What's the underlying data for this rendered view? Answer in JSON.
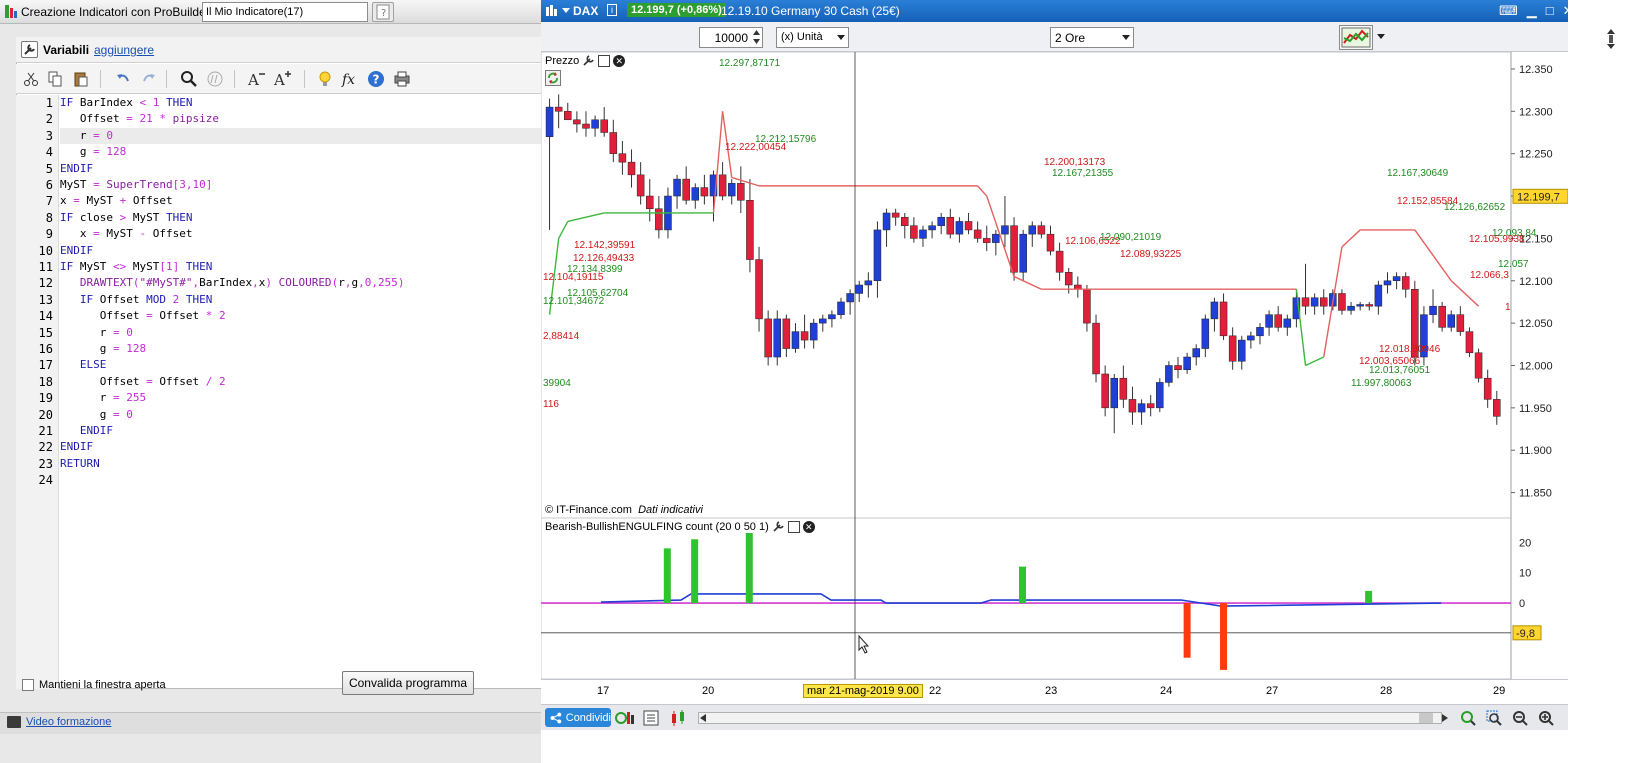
{
  "left_window": {
    "title": "Creazione Indicatori con ProBuilder",
    "separator": "-",
    "indicator_name": "Il Mio Indicatore(17)",
    "variables_label": "Variabili",
    "add_link": "aggiungere",
    "code_lines": [
      "IF BarIndex < 1 THEN",
      "   Offset = 21 * pipsize",
      "   r = 0",
      "   g = 128",
      "ENDIF",
      "MyST = SuperTrend[3,10]",
      "x = MyST + Offset",
      "IF close > MyST THEN",
      "   x = MyST - Offset",
      "ENDIF",
      "IF MyST <> MyST[1] THEN",
      "   DRAWTEXT(\"#MyST#\",BarIndex,x) COLOURED(r,g,0,255)",
      "   IF Offset MOD 2 THEN",
      "      Offset = Offset * 2",
      "      r = 0",
      "      g = 128",
      "   ELSE",
      "      Offset = Offset / 2",
      "      r = 255",
      "      g = 0",
      "   ENDIF",
      "ENDIF",
      "RETURN",
      ""
    ],
    "line_numbers": [
      "1",
      "2",
      "3",
      "4",
      "5",
      "6",
      "7",
      "8",
      "9",
      "10",
      "11",
      "12",
      "13",
      "14",
      "15",
      "16",
      "17",
      "18",
      "19",
      "20",
      "21",
      "22",
      "23",
      "24"
    ],
    "keep_open_label": "Mantieni la finestra aperta",
    "validate_button": "Convalida programma",
    "video_link": "Video formazione"
  },
  "chart_window": {
    "symbol": "DAX",
    "price_badge": "12.199,7 (+0,86%)",
    "description": "12.19.10 Germany 30 Cash (25€)",
    "quantity": "10000",
    "unit": "(x) Unità",
    "timeframe": "2 Ore",
    "panel1_label": "Prezzo",
    "panel2_label": "Bearish-BullishENGULFING count (20 0 50 1)",
    "copyright": "© IT-Finance.com",
    "copyright_note": "Dati indicativi",
    "share_button": "Condividi",
    "cursor_date": "mar 21-mag-2019 9.00",
    "x_labels": [
      "17",
      "20",
      "22",
      "23",
      "24",
      "27",
      "28",
      "29"
    ],
    "price_axis": [
      "12.350",
      "12.300",
      "12.250",
      "12.200",
      "12.150",
      "12.100",
      "12.050",
      "12.000",
      "11.950",
      "11.900",
      "11.850"
    ],
    "last_price": "12.199,7",
    "ind_axis": [
      "20",
      "10",
      "0"
    ],
    "ind_cursor_value": "-9,8",
    "colors": {
      "up": "#1f3fd6",
      "down": "#e0203a",
      "st_red": "#e46060",
      "st_green": "#3cb83c",
      "text_red": "#d01818",
      "text_green": "#1f8c1f",
      "title_blue": "#1f6fc8",
      "badge_green": "#2e9e31"
    }
  },
  "chart_data": {
    "type": "candlestick",
    "price_labels": [
      {
        "text": "12.297,87171",
        "color": "green"
      },
      {
        "text": "12.212,15796",
        "color": "green"
      },
      {
        "text": "12.222,00454",
        "color": "red"
      },
      {
        "text": "12.200,13173",
        "color": "red"
      },
      {
        "text": "12.167,21355",
        "color": "green"
      },
      {
        "text": "12.142,39591",
        "color": "red"
      },
      {
        "text": "12.126,49433",
        "color": "red"
      },
      {
        "text": "12.104,19115",
        "color": "red"
      },
      {
        "text": "12.134,8399",
        "color": "green"
      },
      {
        "text": "12.105,62704",
        "color": "green"
      },
      {
        "text": "12.101,34672",
        "color": "green"
      },
      {
        "text": "2,88414",
        "color": "red"
      },
      {
        "text": "39904",
        "color": "green"
      },
      {
        "text": "116",
        "color": "red"
      },
      {
        "text": "12.106,6522",
        "color": "red"
      },
      {
        "text": "12.090,21019",
        "color": "green"
      },
      {
        "text": "12.089,93225",
        "color": "red"
      },
      {
        "text": "12.167,30649",
        "color": "green"
      },
      {
        "text": "12.152,85584",
        "color": "red"
      },
      {
        "text": "12.126,62652",
        "color": "green"
      },
      {
        "text": "12.093,84",
        "color": "green"
      },
      {
        "text": "12.105,9938",
        "color": "red"
      },
      {
        "text": "12.057",
        "color": "green"
      },
      {
        "text": "12.066,3",
        "color": "red"
      },
      {
        "text": "1",
        "color": "red"
      },
      {
        "text": "12.018,30946",
        "color": "red"
      },
      {
        "text": "12.003,65066",
        "color": "red"
      },
      {
        "text": "12.013,76051",
        "color": "green"
      },
      {
        "text": "11.997,80063",
        "color": "green"
      }
    ],
    "candles": [
      [
        12270,
        12315,
        12160,
        12305
      ],
      [
        12305,
        12320,
        12280,
        12300
      ],
      [
        12300,
        12310,
        12290,
        12290
      ],
      [
        12290,
        12300,
        12275,
        12285
      ],
      [
        12285,
        12300,
        12270,
        12280
      ],
      [
        12280,
        12295,
        12270,
        12290
      ],
      [
        12290,
        12305,
        12270,
        12275
      ],
      [
        12275,
        12290,
        12240,
        12250
      ],
      [
        12250,
        12265,
        12225,
        12240
      ],
      [
        12240,
        12255,
        12210,
        12225
      ],
      [
        12225,
        12240,
        12190,
        12200
      ],
      [
        12200,
        12220,
        12170,
        12185
      ],
      [
        12185,
        12200,
        12150,
        12160
      ],
      [
        12160,
        12210,
        12150,
        12200
      ],
      [
        12200,
        12225,
        12185,
        12220
      ],
      [
        12220,
        12235,
        12190,
        12195
      ],
      [
        12195,
        12215,
        12185,
        12210
      ],
      [
        12210,
        12225,
        12190,
        12200
      ],
      [
        12200,
        12230,
        12170,
        12225
      ],
      [
        12225,
        12240,
        12195,
        12200
      ],
      [
        12200,
        12220,
        12190,
        12215
      ],
      [
        12215,
        12235,
        12180,
        12195
      ],
      [
        12195,
        12220,
        12110,
        12125
      ],
      [
        12125,
        12140,
        12040,
        12055
      ],
      [
        12055,
        12065,
        12000,
        12010
      ],
      [
        12010,
        12065,
        12000,
        12055
      ],
      [
        12055,
        12060,
        12010,
        12020
      ],
      [
        12020,
        12050,
        12015,
        12040
      ],
      [
        12040,
        12060,
        12020,
        12030
      ],
      [
        12030,
        12055,
        12020,
        12050
      ],
      [
        12050,
        12060,
        12040,
        12055
      ],
      [
        12055,
        12065,
        12045,
        12060
      ],
      [
        12060,
        12080,
        12055,
        12075
      ],
      [
        12075,
        12090,
        12060,
        12085
      ],
      [
        12085,
        12100,
        12075,
        12095
      ],
      [
        12095,
        12110,
        12080,
        12100
      ],
      [
        12100,
        12170,
        12080,
        12160
      ],
      [
        12160,
        12185,
        12140,
        12180
      ],
      [
        12180,
        12185,
        12165,
        12175
      ],
      [
        12175,
        12180,
        12150,
        12165
      ],
      [
        12165,
        12175,
        12145,
        12150
      ],
      [
        12150,
        12165,
        12140,
        12160
      ],
      [
        12160,
        12170,
        12150,
        12165
      ],
      [
        12165,
        12180,
        12155,
        12175
      ],
      [
        12175,
        12185,
        12150,
        12155
      ],
      [
        12155,
        12175,
        12145,
        12170
      ],
      [
        12170,
        12180,
        12155,
        12160
      ],
      [
        12160,
        12170,
        12145,
        12150
      ],
      [
        12150,
        12165,
        12135,
        12145
      ],
      [
        12145,
        12160,
        12130,
        12155
      ],
      [
        12155,
        12200,
        12140,
        12165
      ],
      [
        12165,
        12175,
        12100,
        12110
      ],
      [
        12110,
        12160,
        12100,
        12155
      ],
      [
        12155,
        12170,
        12140,
        12165
      ],
      [
        12165,
        12170,
        12150,
        12155
      ],
      [
        12155,
        12165,
        12130,
        12135
      ],
      [
        12135,
        12145,
        12100,
        12110
      ],
      [
        12110,
        12115,
        12085,
        12095
      ],
      [
        12095,
        12105,
        12080,
        12090
      ],
      [
        12090,
        12095,
        12040,
        12050
      ],
      [
        12050,
        12060,
        11980,
        11990
      ],
      [
        11990,
        12000,
        11940,
        11950
      ],
      [
        11950,
        11990,
        11920,
        11985
      ],
      [
        11985,
        12000,
        11950,
        11960
      ],
      [
        11960,
        11975,
        11930,
        11945
      ],
      [
        11945,
        11960,
        11930,
        11955
      ],
      [
        11955,
        11965,
        11940,
        11950
      ],
      [
        11950,
        11985,
        11945,
        11980
      ],
      [
        11980,
        12005,
        11975,
        12000
      ],
      [
        12000,
        12010,
        11985,
        11995
      ],
      [
        11995,
        12015,
        11990,
        12010
      ],
      [
        12010,
        12025,
        12000,
        12020
      ],
      [
        12020,
        12060,
        12010,
        12055
      ],
      [
        12055,
        12080,
        12040,
        12075
      ],
      [
        12075,
        12085,
        12030,
        12035
      ],
      [
        12035,
        12045,
        11995,
        12005
      ],
      [
        12005,
        12035,
        11995,
        12030
      ],
      [
        12030,
        12040,
        12020,
        12035
      ],
      [
        12035,
        12050,
        12025,
        12045
      ],
      [
        12045,
        12065,
        12035,
        12060
      ],
      [
        12060,
        12070,
        12040,
        12045
      ],
      [
        12045,
        12060,
        12035,
        12055
      ],
      [
        12055,
        12090,
        12045,
        12080
      ],
      [
        12080,
        12120,
        12060,
        12070
      ],
      [
        12070,
        12085,
        12060,
        12080
      ],
      [
        12080,
        12090,
        12060,
        12070
      ],
      [
        12070,
        12090,
        12065,
        12085
      ],
      [
        12085,
        12090,
        12060,
        12065
      ],
      [
        12065,
        12075,
        12060,
        12070
      ],
      [
        12070,
        12075,
        12065,
        12072
      ],
      [
        12072,
        12075,
        12065,
        12070
      ],
      [
        12070,
        12100,
        12060,
        12095
      ],
      [
        12095,
        12110,
        12085,
        12100
      ],
      [
        12100,
        12110,
        12090,
        12105
      ],
      [
        12105,
        12110,
        12080,
        12090
      ],
      [
        12090,
        12100,
        12000,
        12010
      ],
      [
        12010,
        12070,
        12000,
        12060
      ],
      [
        12060,
        12090,
        12050,
        12070
      ],
      [
        12070,
        12075,
        12040,
        12045
      ],
      [
        12045,
        12065,
        12040,
        12060
      ],
      [
        12060,
        12070,
        12035,
        12040
      ],
      [
        12040,
        12045,
        12010,
        12015
      ],
      [
        12015,
        12020,
        11980,
        11985
      ],
      [
        11985,
        11995,
        11950,
        11960
      ],
      [
        11960,
        11970,
        11930,
        11940
      ]
    ],
    "engulfing_bars": [
      {
        "index": 7,
        "value": 18,
        "color": "green"
      },
      {
        "index": 10,
        "value": 21,
        "color": "green"
      },
      {
        "index": 16,
        "value": 25,
        "color": "green"
      },
      {
        "index": 46,
        "value": 12,
        "color": "green"
      },
      {
        "index": 70,
        "value": -18,
        "color": "red"
      },
      {
        "index": 74,
        "value": -22,
        "color": "red"
      },
      {
        "index": 84,
        "value": 4,
        "color": "green"
      }
    ],
    "ylim": [
      11820,
      12370
    ],
    "ind_ylim": [
      -25,
      28
    ]
  }
}
